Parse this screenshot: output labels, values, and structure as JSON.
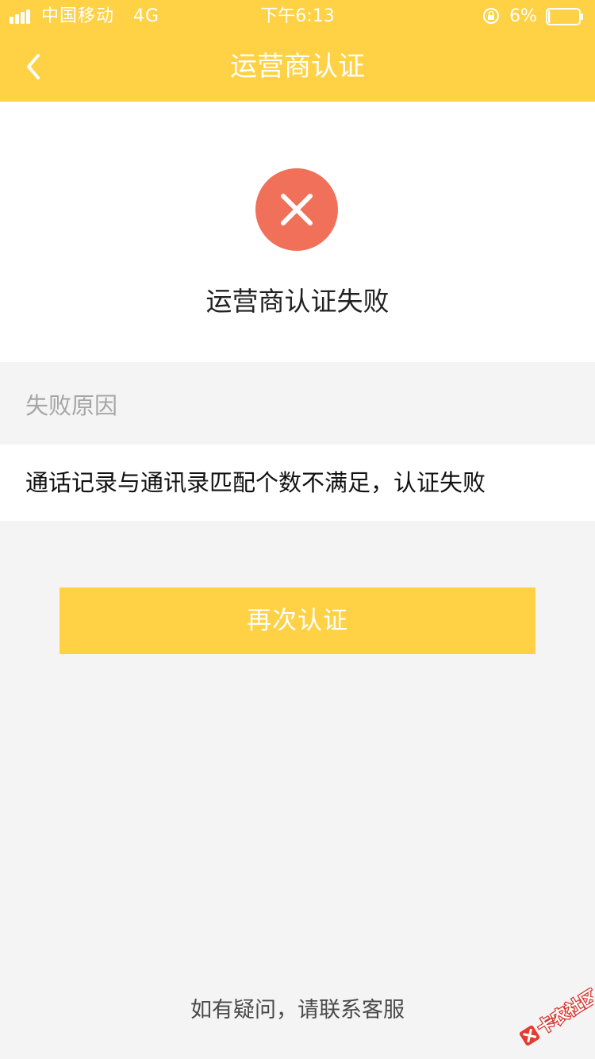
{
  "status_bar": {
    "carrier": "中国移动",
    "network": "4G",
    "time": "下午6:13",
    "battery_percent": "6%",
    "battery_level": 0.06,
    "icons": [
      "signal-bars-icon",
      "rotation-lock-icon",
      "battery-icon"
    ]
  },
  "nav": {
    "back_icon": "chevron-left-icon",
    "title": "运营商认证"
  },
  "result": {
    "icon": "error-x-icon",
    "message": "运营商认证失败"
  },
  "reason": {
    "label": "失败原因",
    "text": "通话记录与通讯录匹配个数不满足，认证失败"
  },
  "retry_button": {
    "label": "再次认证"
  },
  "contact": {
    "text": "如有疑问，请联系客服"
  },
  "watermark": {
    "text": "卡农社区"
  },
  "colors": {
    "accent": "#ffd145",
    "error_red": "#f0705a",
    "background": "#f4f4f4"
  }
}
